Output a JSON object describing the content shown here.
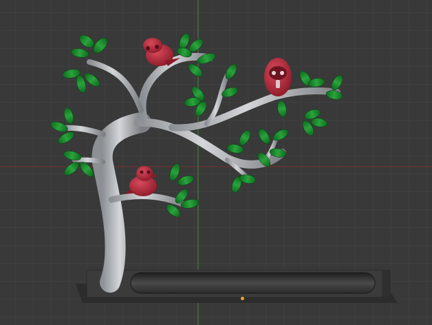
{
  "viewport": {
    "background": "#393939",
    "grid_minor_color": "#454545",
    "grid_major_color": "#4e4e4e",
    "x_axis_color": "#7a2e2e",
    "y_axis_color": "#3f8a3f"
  },
  "model": {
    "trunk_color": "#b9bcc0",
    "leaf_color": "#1e8a2e",
    "bird_color": "#b82a3c",
    "base_color": "#3a3a3a",
    "bird_count": 3
  },
  "origin_marker_color": "#f0a020"
}
